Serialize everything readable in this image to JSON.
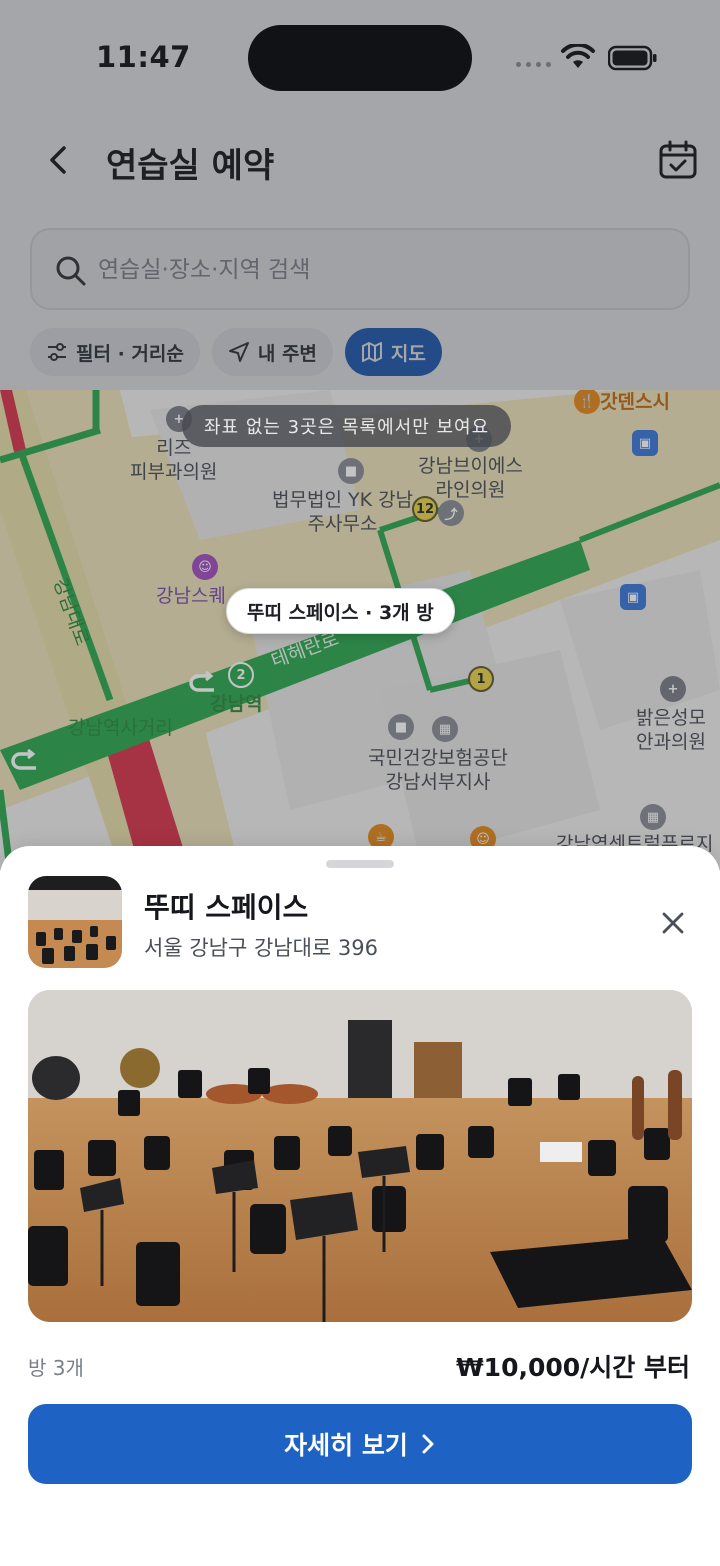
{
  "status_bar": {
    "time": "11:47"
  },
  "header": {
    "title": "연습실 예약",
    "back_icon": "chevron-left-icon",
    "calendar_icon": "calendar-check-icon"
  },
  "search": {
    "placeholder": "연습실·장소·지역 검색",
    "value": ""
  },
  "chips": [
    {
      "label": "필터 · 거리순",
      "icon": "sliders-icon",
      "active": false
    },
    {
      "label": "내 주변",
      "icon": "navigation-arrow-icon",
      "active": false
    },
    {
      "label": "지도",
      "icon": "map-icon",
      "active": true
    }
  ],
  "map": {
    "notice": "좌표 없는 3곳은 목록에서만 보여요",
    "marker": "뚜띠 스페이스 · 3개 방",
    "labels": {
      "gatdensushi": "갓덴스시",
      "riz_clinic": "리즈\n피부과의원",
      "gangnam_bies": "강남브이에스\n라인의원",
      "yk_law": "법무법인 YK 강남\n주사무소",
      "gangnam_sky": "강남스퀘",
      "gangnam_daero": "강남대로",
      "teheran_ro": "테헤란로",
      "gangnam_station": "강남역",
      "gangnam_crossroad": "강남역사거리",
      "nhis": "국민건강보험공단\n강남서부지사",
      "bright_eye": "밝은성모\n안과의원",
      "gangnam_center": "강남역센트럴푸르지",
      "line2_num": "2",
      "exit_12": "12",
      "exit_1": "1"
    }
  },
  "venue": {
    "name": "뚜띠 스페이스",
    "address": "서울 강남구 강남대로 396",
    "rooms": "방 3개",
    "price": "₩10,000/시간 부터",
    "cta": "자세히 보기"
  },
  "colors": {
    "accent": "#1e63c4",
    "line2_green": "#2fa84f",
    "road_red": "#d7364a"
  }
}
